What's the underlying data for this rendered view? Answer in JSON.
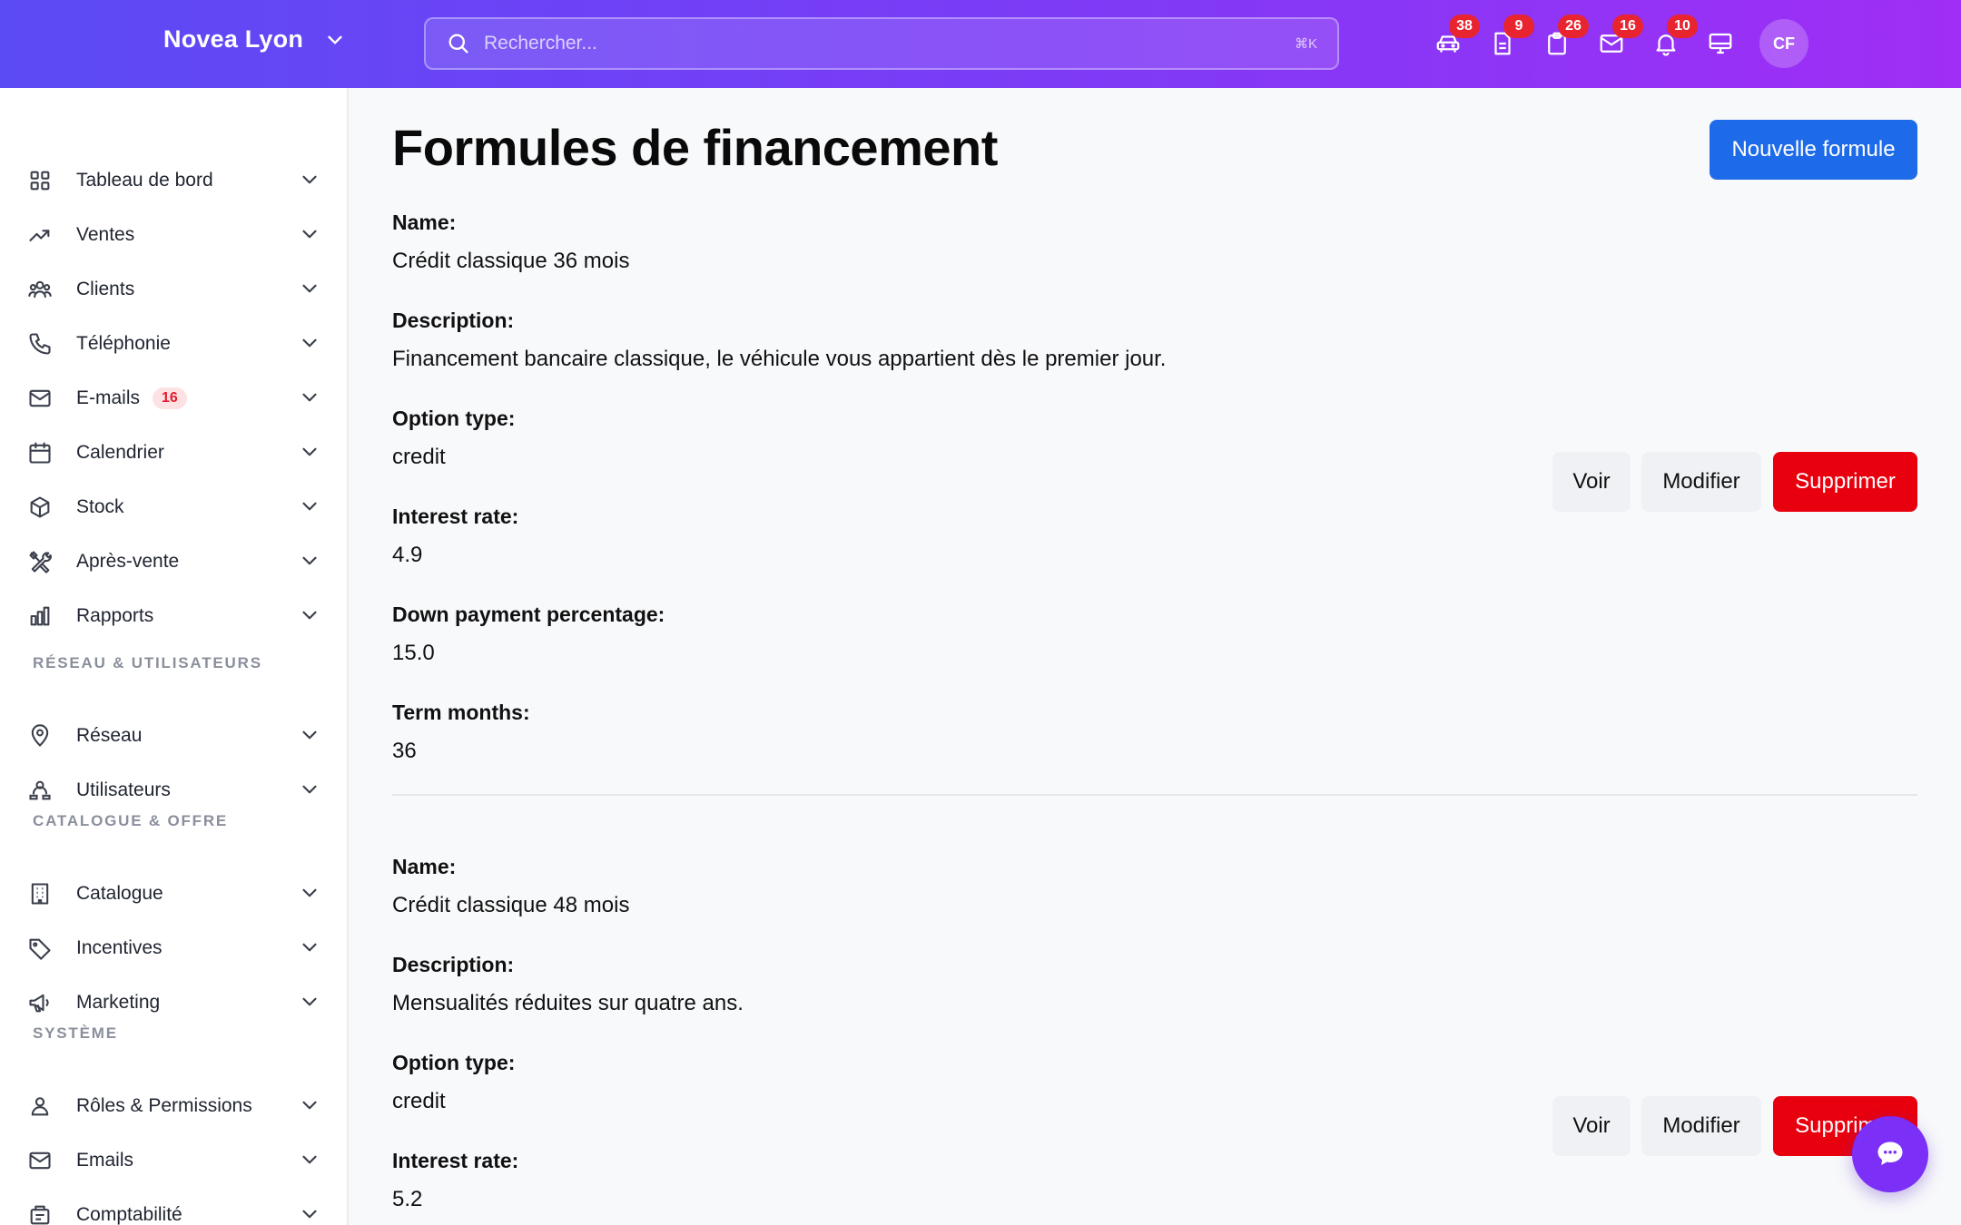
{
  "app": {
    "brand": "Novea Lyon",
    "search_placeholder": "Rechercher...",
    "search_shortcut": "⌘K",
    "avatar_initials": "CF",
    "top_icons": [
      {
        "icon": "car-icon",
        "count": "38"
      },
      {
        "icon": "document-icon",
        "count": "9"
      },
      {
        "icon": "clipboard-icon",
        "count": "26"
      },
      {
        "icon": "mail-icon",
        "count": "16"
      },
      {
        "icon": "bell-icon",
        "count": "10"
      },
      {
        "icon": "monitor-icon",
        "count": ""
      }
    ]
  },
  "sidebar": {
    "items": [
      {
        "label": "Tableau de bord",
        "icon": "dashboard-grid-icon"
      },
      {
        "label": "Ventes",
        "icon": "trending-up-icon"
      },
      {
        "label": "Clients",
        "icon": "users-icon"
      },
      {
        "label": "Téléphonie",
        "icon": "phone-icon"
      },
      {
        "label": "E-mails",
        "icon": "mail-icon",
        "badge": "16"
      },
      {
        "label": "Calendrier",
        "icon": "calendar-icon"
      },
      {
        "label": "Stock",
        "icon": "box-icon"
      },
      {
        "label": "Après-vente",
        "icon": "tools-icon"
      },
      {
        "label": "Rapports",
        "icon": "bar-chart-icon"
      }
    ],
    "sections": [
      {
        "title": "RÉSEAU & UTILISATEURS",
        "items": [
          {
            "label": "Réseau",
            "icon": "map-pin-icon"
          },
          {
            "label": "Utilisateurs",
            "icon": "user-group-icon"
          }
        ]
      },
      {
        "title": "CATALOGUE & OFFRE",
        "items": [
          {
            "label": "Catalogue",
            "icon": "building-icon"
          },
          {
            "label": "Incentives",
            "icon": "tag-icon"
          },
          {
            "label": "Marketing",
            "icon": "megaphone-icon"
          }
        ]
      },
      {
        "title": "SYSTÈME",
        "items": [
          {
            "label": "Rôles & Permissions",
            "icon": "user-icon"
          },
          {
            "label": "Emails",
            "icon": "mail-icon"
          },
          {
            "label": "Comptabilité",
            "icon": "accounting-icon"
          }
        ]
      }
    ]
  },
  "main": {
    "title": "Formules de financement",
    "new_button": "Nouvelle formule",
    "actions": {
      "view": "Voir",
      "edit": "Modifier",
      "delete": "Supprimer"
    },
    "records": [
      {
        "fields": [
          {
            "label": "Name:",
            "value": "Crédit classique 36 mois"
          },
          {
            "label": "Description:",
            "value": "Financement bancaire classique, le véhicule vous appartient dès le premier jour."
          },
          {
            "label": "Option type:",
            "value": "credit"
          },
          {
            "label": "Interest rate:",
            "value": "4.9"
          },
          {
            "label": "Down payment percentage:",
            "value": "15.0"
          },
          {
            "label": "Term months:",
            "value": "36"
          }
        ]
      },
      {
        "fields": [
          {
            "label": "Name:",
            "value": "Crédit classique 48 mois"
          },
          {
            "label": "Description:",
            "value": "Mensualités réduites sur quatre ans."
          },
          {
            "label": "Option type:",
            "value": "credit"
          },
          {
            "label": "Interest rate:",
            "value": "5.2"
          }
        ]
      }
    ]
  },
  "colors": {
    "topbar_start": "#5b4bf5",
    "topbar_end": "#a02ef5",
    "primary": "#1e6bea",
    "danger": "#e8000e",
    "badge": "#e8242f",
    "chat": "#7b2ff7"
  }
}
